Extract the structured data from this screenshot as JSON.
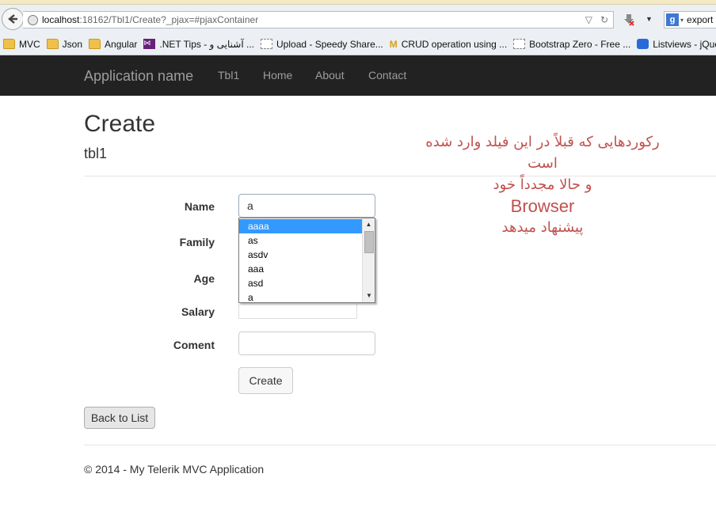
{
  "browser": {
    "url_host": "localhost",
    "url_path": ":18162/Tbl1/Create?_pjax=#pjaxContainer",
    "search_text": "export",
    "bookmarks": [
      {
        "label": "MVC",
        "icon": "folder-icon"
      },
      {
        "label": "Json",
        "icon": "folder-icon"
      },
      {
        "label": "Angular",
        "icon": "folder-icon"
      },
      {
        "label": ".NET Tips - آشنایی و ...",
        "icon": "visual-studio-icon"
      },
      {
        "label": "Upload - Speedy Share...",
        "icon": "page-icon"
      },
      {
        "label": "CRUD operation using ...",
        "icon": "m-logo-icon"
      },
      {
        "label": "Bootstrap Zero - Free ...",
        "icon": "page-icon"
      },
      {
        "label": "Listviews - jQue",
        "icon": "listviews-icon"
      }
    ]
  },
  "navbar": {
    "brand": "Application name",
    "links": [
      "Tbl1",
      "Home",
      "About",
      "Contact"
    ]
  },
  "page": {
    "title": "Create",
    "subtitle": "tbl1"
  },
  "annotation": {
    "line1": "رکوردهایی که قبلاً در این فیلد وارد شده",
    "line2": "است",
    "line3": "و حالا مجدداً خود",
    "line4": "Browser",
    "line5": "پیشنهاد میدهد",
    "color": "#c0504d"
  },
  "form": {
    "fields": [
      {
        "label": "Name",
        "value": "a"
      },
      {
        "label": "Family",
        "value": ""
      },
      {
        "label": "Age",
        "value": ""
      },
      {
        "label": "Salary",
        "value": ""
      },
      {
        "label": "Coment",
        "value": ""
      }
    ],
    "submit_label": "Create",
    "autocomplete": [
      "aaaa",
      "as",
      "asdv",
      "aaa",
      "asd",
      "a"
    ],
    "autocomplete_selected": "aaaa"
  },
  "back_link": "Back to List",
  "footer": "© 2014 - My Telerik MVC Application"
}
